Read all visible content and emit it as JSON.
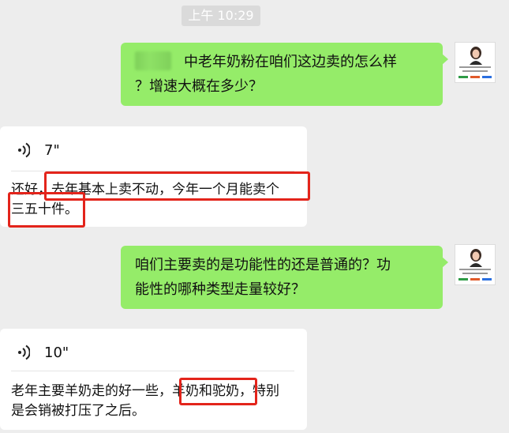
{
  "timestamp": "上午 10:29",
  "messages": [
    {
      "direction": "outgoing",
      "lines": [
        "中老年奶粉在咱们这边卖的怎么样",
        "？增速大概在多少？"
      ]
    },
    {
      "direction": "incoming",
      "type": "voice",
      "duration": "7\"",
      "transcript_lines": [
        "还好，去年基本上卖不动，今年一个月能卖个",
        "三五十件。"
      ]
    },
    {
      "direction": "outgoing",
      "lines": [
        "咱们主要卖的是功能性的还是普通的？功",
        "能性的哪种类型走量较好？"
      ]
    },
    {
      "direction": "incoming",
      "type": "voice",
      "duration": "10\"",
      "transcript_lines": [
        "老年主要羊奶走的好一些，羊奶和驼奶，特别",
        "是会销被打压了之后。"
      ]
    }
  ],
  "colors": {
    "outgoing_bubble": "#95ec69",
    "highlight": "#e3241b",
    "background": "#ededed"
  }
}
